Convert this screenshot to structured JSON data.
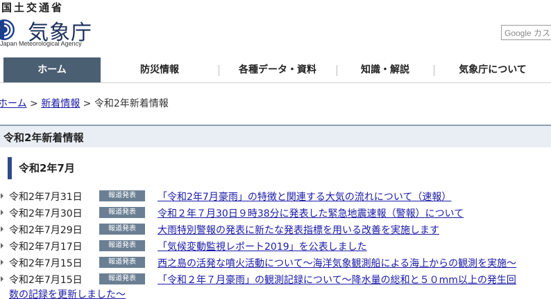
{
  "header": {
    "agency_top": "国土交通省",
    "agency_name": "気象庁",
    "agency_en": "Japan Meteorological Agency",
    "search_placeholder": "Google カスタム検索"
  },
  "nav": {
    "items": [
      {
        "label": "ホーム",
        "active": true
      },
      {
        "label": "防災情報"
      },
      {
        "label": "各種データ・資料"
      },
      {
        "label": "知識・解説"
      },
      {
        "label": "気象庁について"
      }
    ]
  },
  "breadcrumb": {
    "home": "ホーム",
    "sep1": " > ",
    "news": "新着情報",
    "sep2": " > ",
    "current": "令和2年新着情報"
  },
  "page_title": "令和2年新着情報",
  "section_heading": "令和2年7月",
  "news": [
    {
      "date": "令和2年7月31日",
      "badge": "報道発表",
      "title": "「令和2年7月豪雨」の特徴と関連する大気の流れについて（速報）"
    },
    {
      "date": "令和2年7月30日",
      "badge": "報道発表",
      "title": "令和２年７月30日９時38分に発表した緊急地震速報（警報）について"
    },
    {
      "date": "令和2年7月29日",
      "badge": "報道発表",
      "title": "大雨特別警報の発表に新たな発表指標を用いる改善を実施します"
    },
    {
      "date": "令和2年7月17日",
      "badge": "報道発表",
      "title": "「気候変動監視レポート2019」を公表しました"
    },
    {
      "date": "令和2年7月15日",
      "badge": "報道発表",
      "title": "西之島の活発な噴火活動について～海洋気象観測船による海上からの観測を実施～"
    },
    {
      "date": "令和2年7月15日",
      "badge": "報道発表",
      "title": "「令和２年７月豪雨」の観測記録について～降水量の総和と５０mm以上の発生回"
    }
  ],
  "news_continuation": "数の記録を更新しました～",
  "colors": {
    "nav_active_bg": "#4b5f73",
    "link": "#1a1aa6",
    "badge_bg": "#6b7f93",
    "title_bar_bg": "#e9eef4",
    "heading_accent": "#2e4a8b"
  }
}
